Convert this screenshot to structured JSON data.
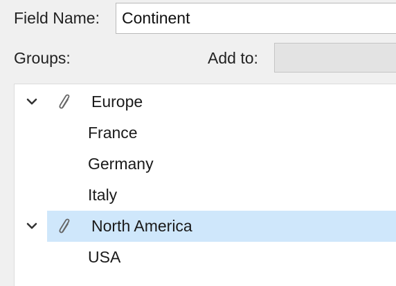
{
  "field_name": {
    "label": "Field Name:",
    "value": "Continent"
  },
  "groups": {
    "label": "Groups:"
  },
  "add_to": {
    "label": "Add to:",
    "value": ""
  },
  "tree": {
    "groups": [
      {
        "name": "Europe",
        "expanded": true,
        "icon": "paperclip-icon",
        "members": [
          "France",
          "Germany",
          "Italy"
        ]
      },
      {
        "name": "North America",
        "expanded": true,
        "selected": true,
        "icon": "paperclip-icon",
        "members": [
          "USA"
        ]
      }
    ]
  },
  "colors": {
    "selection": "#cfe7fb",
    "background": "#f0f0f0",
    "tree_background": "#ffffff"
  }
}
